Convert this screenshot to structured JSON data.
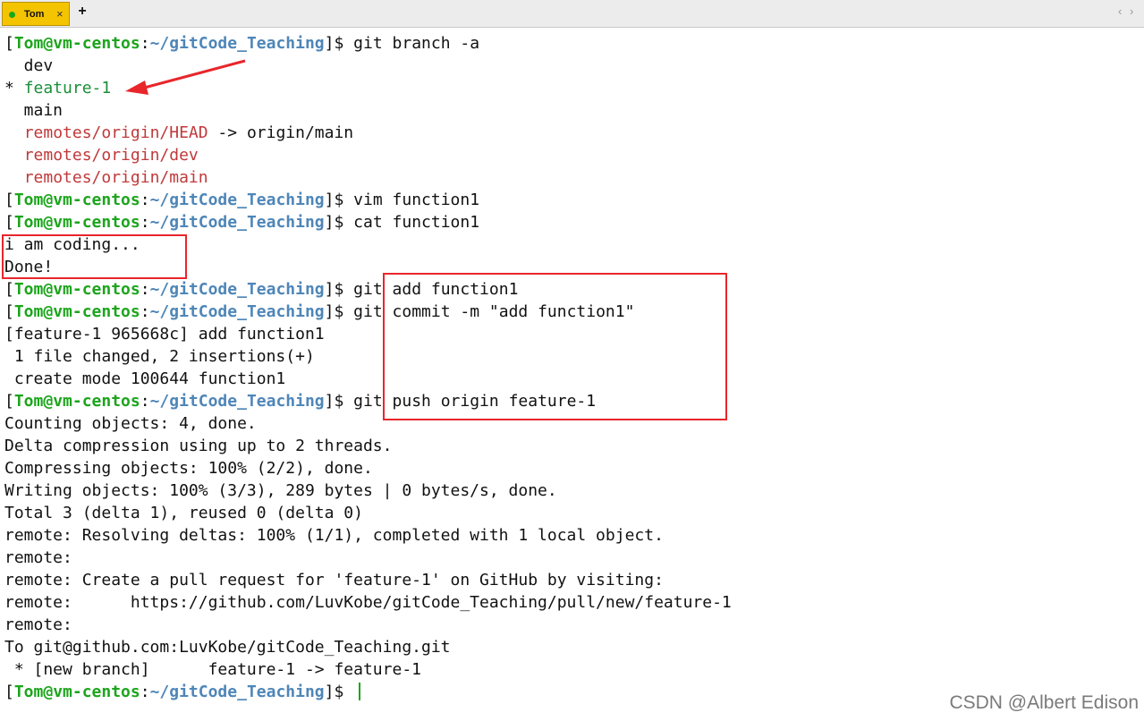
{
  "tabbar": {
    "tab_title": "Tom",
    "close_glyph": "×",
    "new_tab_glyph": "+",
    "scroll_left": "‹",
    "scroll_right": "›"
  },
  "prompt": {
    "open": "[",
    "user": "Tom@vm-centos",
    "sep": ":",
    "path": "~/gitCode_Teaching",
    "close": "]$ "
  },
  "terminal": {
    "lines": [
      {
        "type": "prompt",
        "cmd": "git branch -a"
      },
      {
        "type": "plain",
        "text": "  dev"
      },
      {
        "type": "current",
        "prefix": "* ",
        "text": "feature-1"
      },
      {
        "type": "plain",
        "text": "  main"
      },
      {
        "type": "remote",
        "indent": "  ",
        "text": "remotes/origin/HEAD",
        "suffix": " -> origin/main"
      },
      {
        "type": "remote",
        "indent": "  ",
        "text": "remotes/origin/dev",
        "suffix": ""
      },
      {
        "type": "remote",
        "indent": "  ",
        "text": "remotes/origin/main",
        "suffix": ""
      },
      {
        "type": "prompt",
        "cmd": "vim function1"
      },
      {
        "type": "prompt",
        "cmd": "cat function1"
      },
      {
        "type": "plain",
        "text": "i am coding..."
      },
      {
        "type": "plain",
        "text": "Done!"
      },
      {
        "type": "prompt",
        "cmd": "git add function1"
      },
      {
        "type": "prompt",
        "cmd": "git commit -m \"add function1\""
      },
      {
        "type": "plain",
        "text": "[feature-1 965668c] add function1"
      },
      {
        "type": "plain",
        "text": " 1 file changed, 2 insertions(+)"
      },
      {
        "type": "plain",
        "text": " create mode 100644 function1"
      },
      {
        "type": "prompt",
        "cmd": "git push origin feature-1"
      },
      {
        "type": "plain",
        "text": "Counting objects: 4, done."
      },
      {
        "type": "plain",
        "text": "Delta compression using up to 2 threads."
      },
      {
        "type": "plain",
        "text": "Compressing objects: 100% (2/2), done."
      },
      {
        "type": "plain",
        "text": "Writing objects: 100% (3/3), 289 bytes | 0 bytes/s, done."
      },
      {
        "type": "plain",
        "text": "Total 3 (delta 1), reused 0 (delta 0)"
      },
      {
        "type": "plain",
        "text": "remote: Resolving deltas: 100% (1/1), completed with 1 local object."
      },
      {
        "type": "plain",
        "text": "remote:"
      },
      {
        "type": "plain",
        "text": "remote: Create a pull request for 'feature-1' on GitHub by visiting:"
      },
      {
        "type": "plain",
        "text": "remote:      https://github.com/LuvKobe/gitCode_Teaching/pull/new/feature-1"
      },
      {
        "type": "plain",
        "text": "remote:"
      },
      {
        "type": "plain",
        "text": "To git@github.com:LuvKobe/gitCode_Teaching.git"
      },
      {
        "type": "plain",
        "text": " * [new branch]      feature-1 -> feature-1"
      },
      {
        "type": "prompt",
        "cmd": "",
        "cursor": true
      }
    ]
  },
  "watermark": "CSDN @Albert Edison",
  "colors": {
    "prompt_user": "#1ca51c",
    "prompt_path": "#4e86b8",
    "current_branch": "#1a8f3a",
    "remote_branch": "#c0393b",
    "annotation": "#e8262b",
    "tab": "#f5c400"
  }
}
